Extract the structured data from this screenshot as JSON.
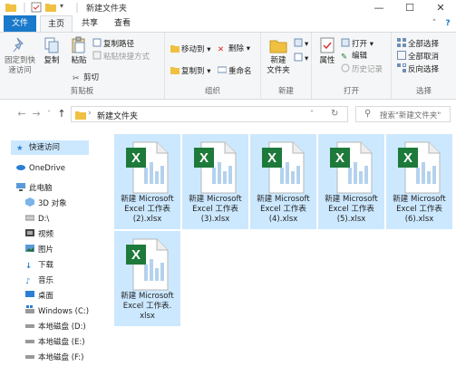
{
  "window": {
    "title": "新建文件夹"
  },
  "tabs": [
    {
      "label": "文件"
    },
    {
      "label": "主页"
    },
    {
      "label": "共享"
    },
    {
      "label": "查看"
    }
  ],
  "ribbon": {
    "clipboard": {
      "label": "剪贴板",
      "pin": "固定到快\n速访问",
      "copy": "复制",
      "paste": "粘贴",
      "copy_path": "复制路径",
      "paste_shortcut": "粘贴快捷方式",
      "cut": "剪切"
    },
    "organize": {
      "label": "组织",
      "move_to": "移动到",
      "copy_to": "复制到",
      "delete": "删除",
      "rename": "重命名"
    },
    "new": {
      "label": "新建",
      "new_folder": "新建\n文件夹"
    },
    "open": {
      "label": "打开",
      "properties": "属性",
      "open": "打开",
      "edit": "编辑",
      "history": "历史记录"
    },
    "select": {
      "label": "选择",
      "select_all": "全部选择",
      "select_none": "全部取消",
      "invert": "反向选择"
    }
  },
  "address": {
    "path": "新建文件夹",
    "search_placeholder": "搜索\"新建文件夹\""
  },
  "nav": {
    "items": [
      {
        "label": "快速访问"
      },
      {
        "label": "OneDrive"
      },
      {
        "label": "此电脑"
      },
      {
        "label": "3D 对象"
      },
      {
        "label": "D:\\"
      },
      {
        "label": "视频"
      },
      {
        "label": "图片"
      },
      {
        "label": "下载"
      },
      {
        "label": "音乐"
      },
      {
        "label": "桌面"
      },
      {
        "label": "Windows (C:)"
      },
      {
        "label": "本地磁盘 (D:)"
      },
      {
        "label": "本地磁盘 (E:)"
      },
      {
        "label": "本地磁盘 (F:)"
      }
    ]
  },
  "files": [
    {
      "line1": "新建 Microsoft",
      "line2": "Excel 工作表",
      "line3": "(2).xlsx"
    },
    {
      "line1": "新建 Microsoft",
      "line2": "Excel 工作表",
      "line3": "(3).xlsx"
    },
    {
      "line1": "新建 Microsoft",
      "line2": "Excel 工作表",
      "line3": "(4).xlsx"
    },
    {
      "line1": "新建 Microsoft",
      "line2": "Excel 工作表",
      "line3": "(5).xlsx"
    },
    {
      "line1": "新建 Microsoft",
      "line2": "Excel 工作表",
      "line3": "(6).xlsx"
    },
    {
      "line1": "新建 Microsoft",
      "line2": "Excel 工作表.",
      "line3": "xlsx"
    }
  ],
  "colors": {
    "accent": "#1979ca",
    "selection": "#cce8ff",
    "excel_green": "#1d7a3a"
  }
}
